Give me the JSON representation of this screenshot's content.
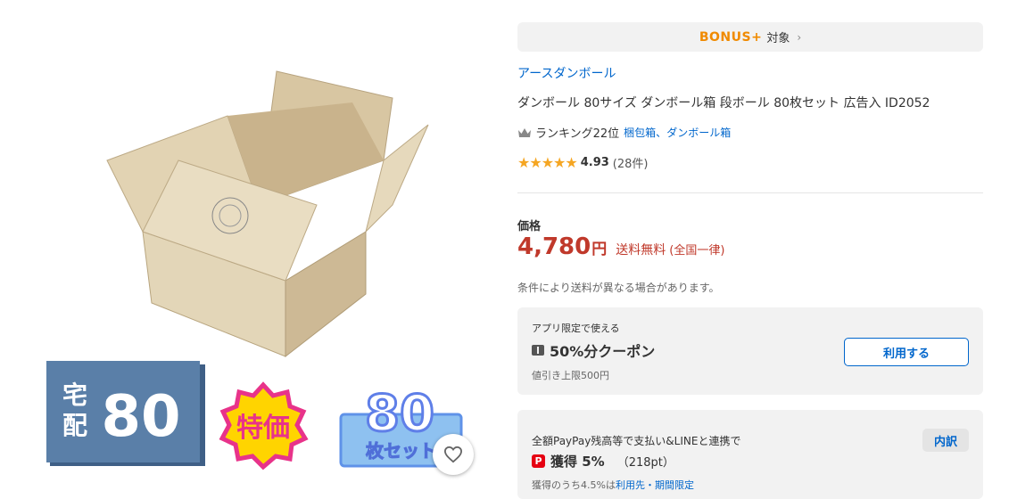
{
  "bonus": {
    "logo": "BONUS+",
    "label": "対象"
  },
  "store_name": "アースダンボール",
  "product_title": "ダンボール 80サイズ ダンボール箱 段ボール 80枚セット 広告入 ID2052",
  "ranking": {
    "text": "ランキング22位",
    "cat1": "梱包箱",
    "sep": "、",
    "cat2": "ダンボール箱"
  },
  "rating": {
    "stars": "★★★★★",
    "score": "4.93",
    "count": "(28件)"
  },
  "price": {
    "label": "価格",
    "value": "4,780",
    "unit": "円",
    "shipping": "送料無料",
    "shipping_note": "(全国一律)",
    "condition": "条件により送料が異なる場合があります。"
  },
  "coupon": {
    "small": "アプリ限定で使える",
    "name": "50%分クーポン",
    "limit": "値引き上限500円",
    "button": "利用する"
  },
  "paypay": {
    "condition": "全額PayPay残高等で支払い&LINEと連携で",
    "icon": "P",
    "earn": "獲得 5%",
    "points": "（218pt）",
    "note_prefix": "獲得のうち4.5%は",
    "note_link": "利用先・期間限定",
    "detail_button": "内訳"
  },
  "badges": {
    "takuhai": "宅配",
    "size": "80",
    "tokka": "特価",
    "set_num": "80",
    "set_label": "枚セット"
  }
}
